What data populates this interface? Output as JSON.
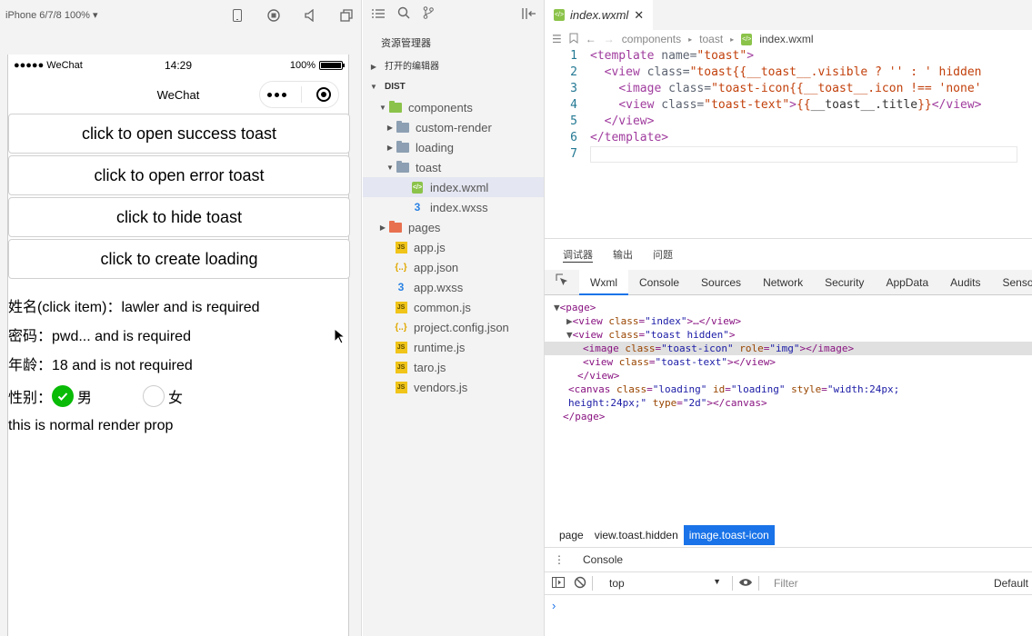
{
  "simulator": {
    "device": "iPhone 6/7/8 100% ▾",
    "status": {
      "carrier": "●●●●● WeChat",
      "time": "14:29",
      "battery": "100%"
    },
    "nav_title": "WeChat",
    "buttons": [
      "click to open success toast",
      "click to open error toast",
      "click to hide toast",
      "click to create loading"
    ],
    "form": {
      "name_line": "姓名(click item)：lawler and is required",
      "pwd_line": "密码：pwd... and is required",
      "age_line": "年龄：18 and is not required",
      "gender_label": "性别：",
      "male": "男",
      "female": "女",
      "normal_line": "this is normal render prop"
    }
  },
  "explorer": {
    "title": "资源管理器",
    "open_editors": "打开的编辑器",
    "root": "DIST",
    "tree": {
      "components": "components",
      "custom_render": "custom-render",
      "loading": "loading",
      "toast": "toast",
      "index_wxml": "index.wxml",
      "index_wxss": "index.wxss",
      "pages": "pages",
      "app_js": "app.js",
      "app_json": "app.json",
      "app_wxss": "app.wxss",
      "common_js": "common.js",
      "project_config": "project.config.json",
      "runtime_js": "runtime.js",
      "taro_js": "taro.js",
      "vendors_js": "vendors.js"
    }
  },
  "editor": {
    "tab_name": "index.wxml",
    "breadcrumb": [
      "components",
      "toast",
      "index.wxml"
    ],
    "lines": [
      {
        "n": "1",
        "indent": "",
        "tag_open": "<template",
        "attr": " name=",
        "val": "\"toast\"",
        "tail": ">"
      },
      {
        "n": "2",
        "indent": "  ",
        "tag_open": "<view",
        "attr": " class=",
        "val": "\"toast{{__toast__.visible ? '' : ' hidden",
        "tail": ""
      },
      {
        "n": "3",
        "indent": "    ",
        "tag_open": "<image",
        "attr": " class=",
        "val": "\"toast-icon{{__toast__.icon !== 'none'",
        "tail": ""
      },
      {
        "n": "4",
        "indent": "    ",
        "tag_open": "<view",
        "attr": " class=",
        "val": "\"toast-text\"",
        "tail": ">{{__toast__.title}}</view>"
      },
      {
        "n": "5",
        "indent": "  ",
        "tag_open": "</view>",
        "attr": "",
        "val": "",
        "tail": ""
      },
      {
        "n": "6",
        "indent": "",
        "tag_open": "</template>",
        "attr": "",
        "val": "",
        "tail": ""
      },
      {
        "n": "7",
        "indent": "",
        "tag_open": "",
        "attr": "",
        "val": "",
        "tail": ""
      }
    ]
  },
  "devtools": {
    "top_tabs": [
      "调试器",
      "输出",
      "问题"
    ],
    "tabs": [
      "Wxml",
      "Console",
      "Sources",
      "Network",
      "Security",
      "AppData",
      "Audits",
      "Sensor"
    ],
    "dom_breadcrumb": [
      "page",
      "view.toast.hidden",
      "image.toast-icon"
    ],
    "console_tab": "Console",
    "context": "top",
    "filter_placeholder": "Filter",
    "levels": "Default"
  }
}
